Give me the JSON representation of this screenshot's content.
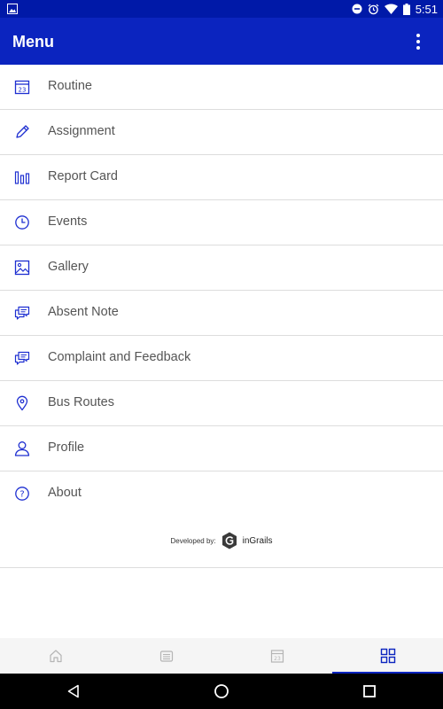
{
  "status_bar": {
    "time": "5:51",
    "icons": [
      "image-icon",
      "do-not-disturb-icon",
      "alarm-icon",
      "wifi-icon",
      "battery-icon"
    ]
  },
  "app_bar": {
    "title": "Menu",
    "overflow_icon": "more-vert-icon"
  },
  "menu": {
    "items": [
      {
        "label": "Routine",
        "icon": "calendar-icon"
      },
      {
        "label": "Assignment",
        "icon": "pencil-icon"
      },
      {
        "label": "Report Card",
        "icon": "bar-chart-icon"
      },
      {
        "label": "Events",
        "icon": "clock-icon"
      },
      {
        "label": "Gallery",
        "icon": "image-icon"
      },
      {
        "label": "Absent Note",
        "icon": "chat-icon"
      },
      {
        "label": "Complaint and Feedback",
        "icon": "chat-icon"
      },
      {
        "label": "Bus Routes",
        "icon": "location-pin-icon"
      },
      {
        "label": "Profile",
        "icon": "user-icon"
      },
      {
        "label": "About",
        "icon": "help-icon"
      }
    ]
  },
  "developer": {
    "label": "Developed by:",
    "brand": "inGrails"
  },
  "bottom_nav": {
    "tabs": [
      {
        "icon": "home-icon",
        "active": false
      },
      {
        "icon": "notice-icon",
        "active": false
      },
      {
        "icon": "calendar-icon",
        "active": false
      },
      {
        "icon": "grid-icon",
        "active": true
      }
    ]
  },
  "colors": {
    "primary": "#0b24bf",
    "status_bar": "#0019a8",
    "icon_blue": "#1e2fd1",
    "text": "#555555"
  }
}
